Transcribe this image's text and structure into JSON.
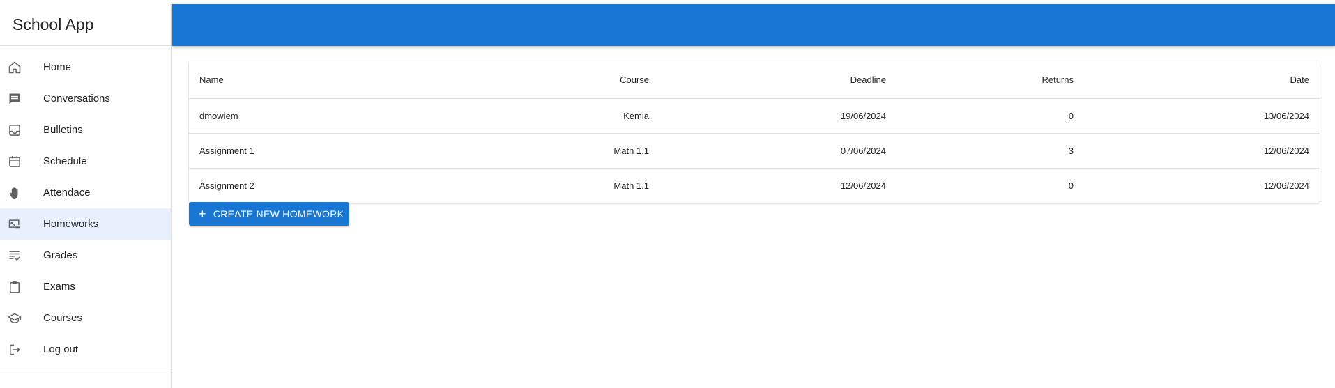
{
  "app": {
    "title": "School App"
  },
  "colors": {
    "accent": "#1976d2",
    "active_item_bg": "#e8f0fe"
  },
  "sidebar": {
    "items": [
      {
        "label": "Home",
        "icon": "home-icon"
      },
      {
        "label": "Conversations",
        "icon": "chat-icon"
      },
      {
        "label": "Bulletins",
        "icon": "inbox-icon"
      },
      {
        "label": "Schedule",
        "icon": "calendar-icon"
      },
      {
        "label": "Attendace",
        "icon": "hand-icon"
      },
      {
        "label": "Homeworks",
        "icon": "homework-icon",
        "active": true
      },
      {
        "label": "Grades",
        "icon": "grades-list-icon"
      },
      {
        "label": "Exams",
        "icon": "clipboard-icon"
      },
      {
        "label": "Courses",
        "icon": "graduation-cap-icon"
      },
      {
        "label": "Log out",
        "icon": "logout-icon"
      }
    ]
  },
  "table": {
    "headers": {
      "name": "Name",
      "course": "Course",
      "deadline": "Deadline",
      "returns": "Returns",
      "date": "Date"
    },
    "rows": [
      {
        "name": "dmowiem",
        "course": "Kemia",
        "deadline": "19/06/2024",
        "returns": "0",
        "date": "13/06/2024"
      },
      {
        "name": "Assignment 1",
        "course": "Math 1.1",
        "deadline": "07/06/2024",
        "returns": "3",
        "date": "12/06/2024"
      },
      {
        "name": "Assignment 2",
        "course": "Math 1.1",
        "deadline": "12/06/2024",
        "returns": "0",
        "date": "12/06/2024"
      }
    ]
  },
  "actions": {
    "create_label": "CREATE NEW HOMEWORK",
    "create_icon": "plus-icon"
  }
}
